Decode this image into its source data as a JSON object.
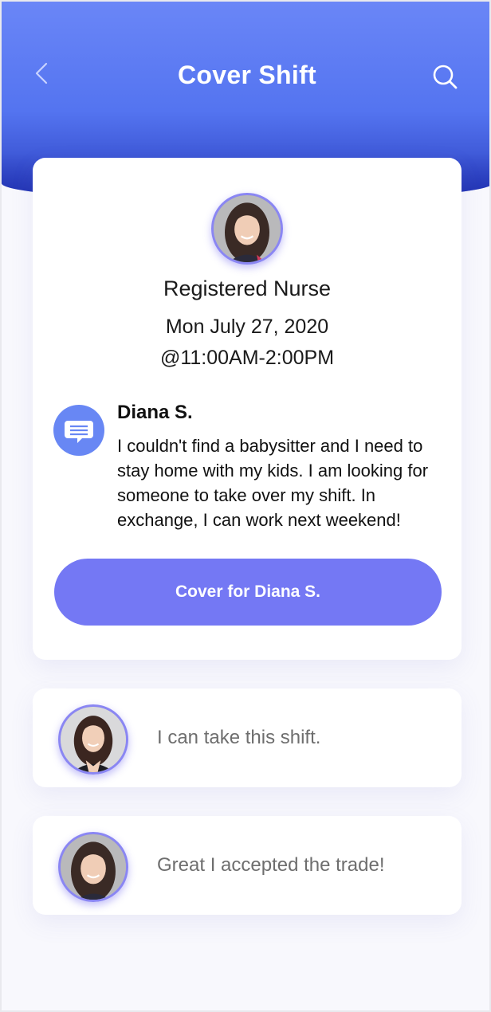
{
  "header": {
    "title": "Cover Shift",
    "back_icon": "chevron-left-icon",
    "search_icon": "search-icon",
    "gradient_top": "#6a86f7",
    "gradient_bottom": "#2a3fc0"
  },
  "shift": {
    "role": "Registered Nurse",
    "date": "Mon July 27, 2020",
    "time": "@11:00AM-2:00PM"
  },
  "request": {
    "icon": "chat-bubble-icon",
    "sender": "Diana S.",
    "message": "I couldn't find a babysitter and I need to stay home with my kids. I am looking for someone to take over my shift. In exchange, I can work next weekend!",
    "button_label": "Cover for Diana S.",
    "button_color": "#7478f4"
  },
  "replies": [
    {
      "text": "I can take this shift."
    },
    {
      "text": "Great I accepted the trade!"
    }
  ]
}
